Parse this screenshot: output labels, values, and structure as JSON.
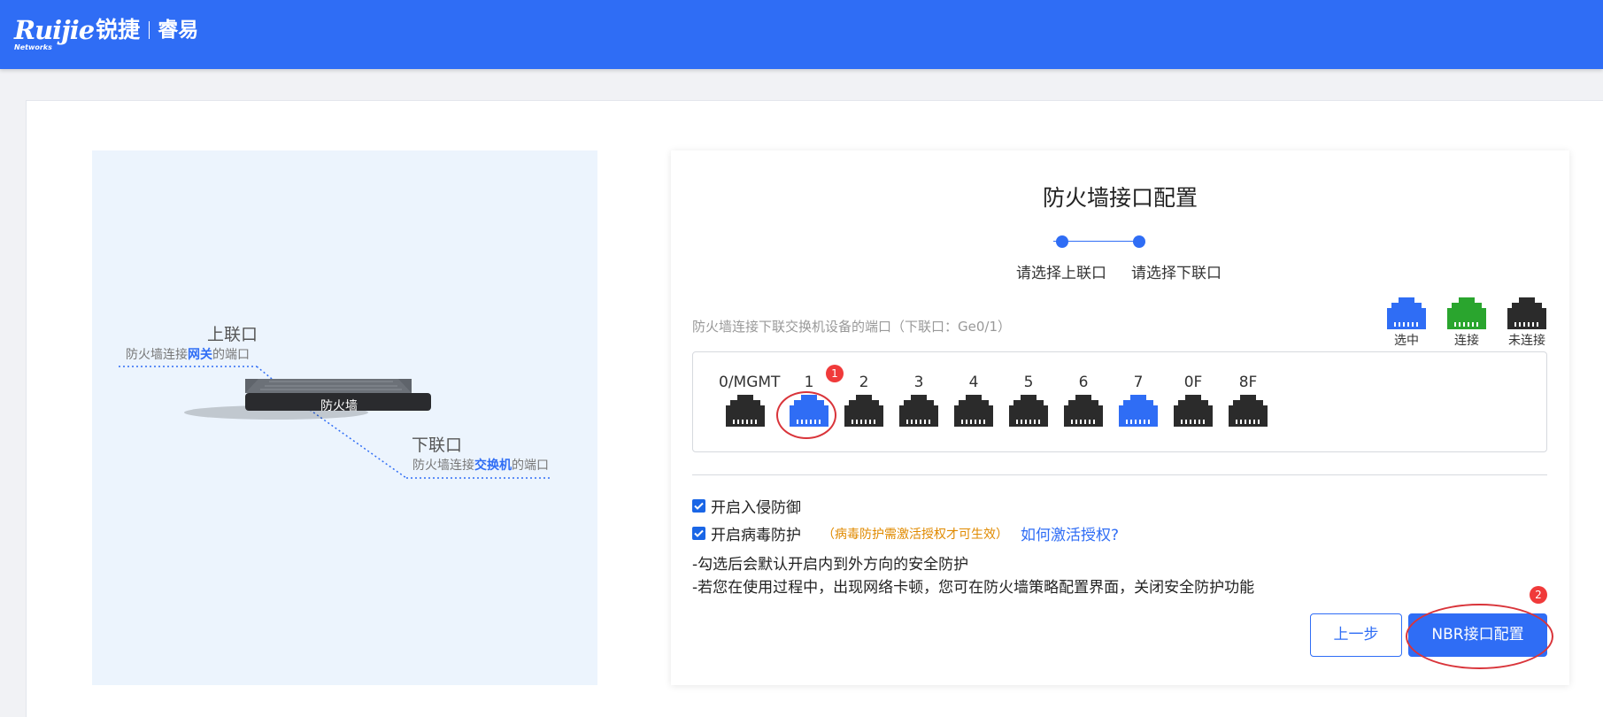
{
  "brand": {
    "logo": "Ruijie",
    "logo_sub": "Networks",
    "logo_cn": "锐捷",
    "product": "睿易"
  },
  "illustration": {
    "uplink_title": "上联口",
    "uplink_desc_pre": "防火墙连接",
    "uplink_desc_hl": "网关",
    "uplink_desc_post": "的端口",
    "device_label": "防火墙",
    "downlink_title": "下联口",
    "downlink_desc_pre": "防火墙连接",
    "downlink_desc_hl": "交换机",
    "downlink_desc_post": "的端口"
  },
  "config": {
    "title": "防火墙接口配置",
    "steps": [
      "请选择上联口",
      "请选择下联口"
    ],
    "hint": "防火墙连接下联交换机设备的端口（下联口：Ge0/1）",
    "legend": [
      {
        "label": "选中",
        "color": "#2f6df5"
      },
      {
        "label": "连接",
        "color": "#2aa52e"
      },
      {
        "label": "未连接",
        "color": "#2b2b2b"
      }
    ],
    "ports": [
      {
        "label": "0/MGMT",
        "state": "unconnected"
      },
      {
        "label": "1",
        "state": "selected"
      },
      {
        "label": "2",
        "state": "unconnected"
      },
      {
        "label": "3",
        "state": "unconnected"
      },
      {
        "label": "4",
        "state": "unconnected"
      },
      {
        "label": "5",
        "state": "unconnected"
      },
      {
        "label": "6",
        "state": "unconnected"
      },
      {
        "label": "7",
        "state": "selected"
      },
      {
        "label": "0F",
        "state": "unconnected"
      },
      {
        "label": "8F",
        "state": "unconnected"
      }
    ],
    "annotations": {
      "badge1": "1",
      "badge2": "2"
    },
    "options": {
      "ips_label": "开启入侵防御",
      "ips_checked": true,
      "av_label": "开启病毒防护",
      "av_checked": true,
      "av_warning": "（病毒防护需激活授权才可生效）",
      "av_link": "如何激活授权?"
    },
    "notes": [
      "-勾选后会默认开启内到外方向的安全防护",
      "-若您在使用过程中，出现网络卡顿，您可在防火墙策略配置界面，关闭安全防护功能"
    ],
    "buttons": {
      "prev": "上一步",
      "next": "NBR接口配置"
    }
  }
}
